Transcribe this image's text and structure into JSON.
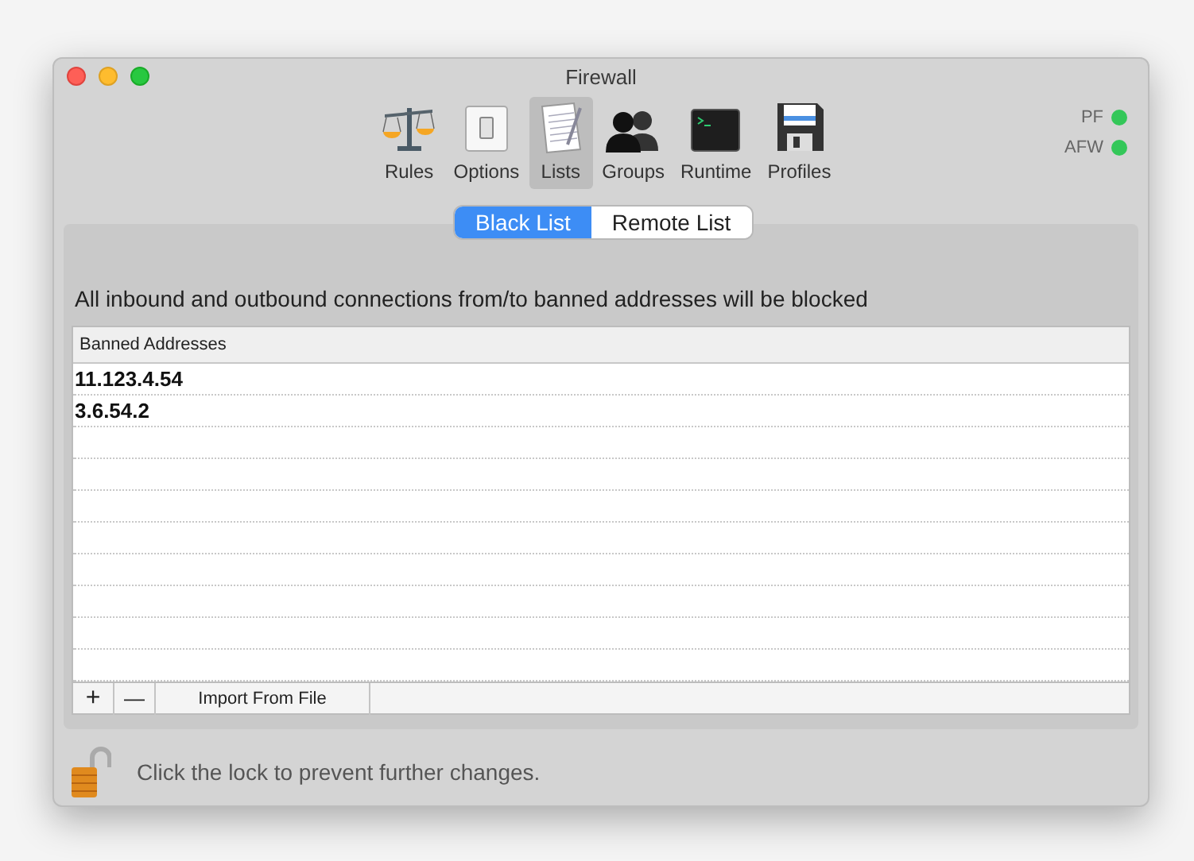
{
  "window": {
    "title": "Firewall"
  },
  "toolbar": [
    {
      "label": "Rules",
      "selected": false
    },
    {
      "label": "Options",
      "selected": false
    },
    {
      "label": "Lists",
      "selected": true
    },
    {
      "label": "Groups",
      "selected": false
    },
    {
      "label": "Runtime",
      "selected": false
    },
    {
      "label": "Profiles",
      "selected": false
    }
  ],
  "status": [
    {
      "label": "PF",
      "on": true
    },
    {
      "label": "AFW",
      "on": true
    }
  ],
  "segments": [
    {
      "label": "Black List",
      "selected": true
    },
    {
      "label": "Remote List",
      "selected": false
    }
  ],
  "description": "All inbound and outbound connections from/to banned addresses will be blocked",
  "table": {
    "columns": [
      "Banned Addresses"
    ],
    "rows": [
      [
        "11.123.4.54"
      ],
      [
        "3.6.54.2"
      ]
    ]
  },
  "table_buttons": [
    "+",
    "—",
    "Import From File"
  ],
  "lock": {
    "locked": false,
    "text": "Click the lock to prevent further changes."
  }
}
